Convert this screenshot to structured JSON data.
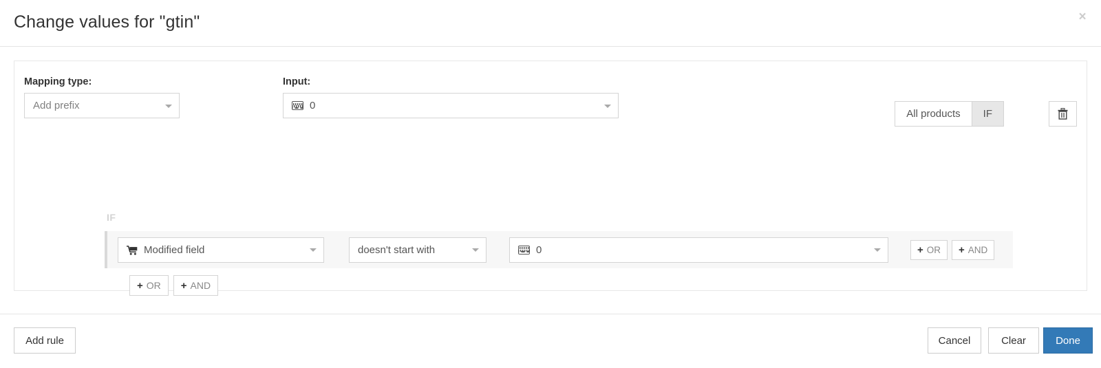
{
  "header": {
    "title": "Change values for \"gtin\"",
    "close_label": "×"
  },
  "rule": {
    "mapping": {
      "label": "Mapping type:",
      "value": "Add prefix",
      "icon": "chevron-down-icon"
    },
    "input": {
      "label": "Input:",
      "value": "0",
      "icon": "keyboard-icon"
    },
    "scope": {
      "all_products_label": "All products",
      "if_label": "IF",
      "selected": "IF"
    },
    "delete": {
      "icon": "trash-icon",
      "label": ""
    },
    "if_section_label": "IF",
    "condition": {
      "field": {
        "value": "Modified field",
        "icon": "cart-icon"
      },
      "operator": {
        "value": "doesn't start with"
      },
      "value": {
        "value": "0",
        "icon": "keyboard-icon"
      },
      "or_label": "OR",
      "and_label": "AND",
      "plus_glyph": "+"
    },
    "add_logic": {
      "or_label": "OR",
      "and_label": "AND",
      "plus_glyph": "+"
    }
  },
  "footer": {
    "add_rule_label": "Add rule",
    "cancel_label": "Cancel",
    "clear_label": "Clear",
    "done_label": "Done"
  },
  "colors": {
    "primary": "#337ab7",
    "border": "#d4d4d4",
    "row_background": "#f7f7f7",
    "muted_text": "#888888"
  }
}
